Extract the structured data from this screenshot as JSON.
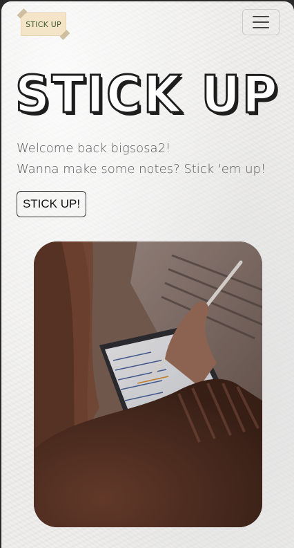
{
  "navbar": {
    "logo_text": "STICK UP",
    "menu_icon": "hamburger-menu-icon"
  },
  "hero": {
    "title": "STICK UP",
    "welcome": "Welcome back bigsosa2!",
    "prompt": "Wanna make some notes? Stick 'em up!",
    "cta_label": "STICK UP!"
  },
  "photo": {
    "notes_lines": [
      "— apuntar en el",
      "sobre la importancia de",
      "· Las dos piezas",
      "el 60 cuida",
      "· Ella 1) Revisión",
      "· y ... lista",
      "— Mi trabajo"
    ]
  },
  "colors": {
    "background": "#efeeed",
    "title_fill": "#ffffff",
    "title_stroke": "#1e1e1e",
    "body_text": "#5a5a5a",
    "logo_bg": "#f4e4c8"
  }
}
